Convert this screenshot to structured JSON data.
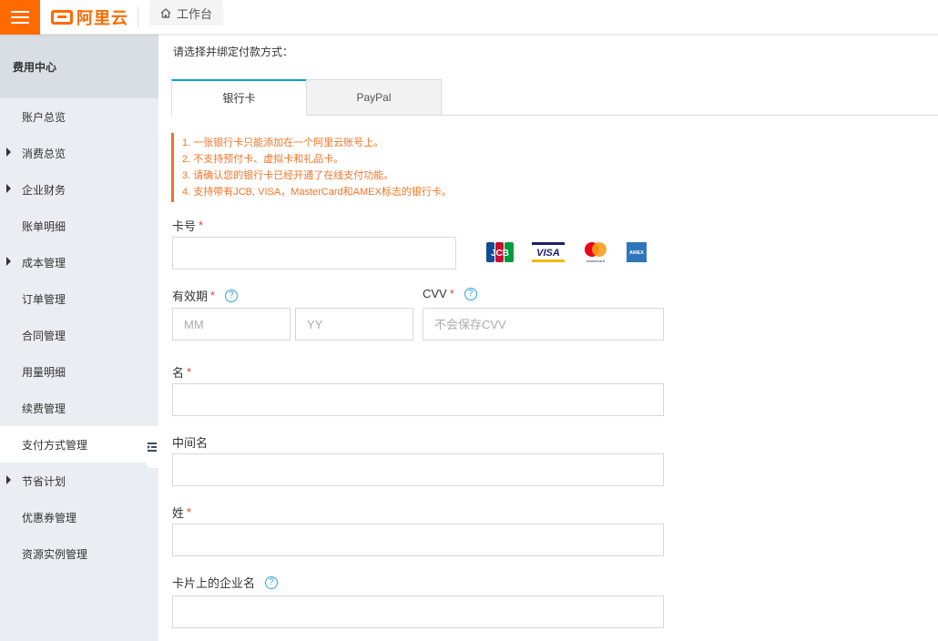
{
  "header": {
    "logo_text": "阿里云",
    "workbench_label": "工作台",
    "brand_color": "#ff6a00"
  },
  "sidebar": {
    "title": "费用中心",
    "items": [
      {
        "label": "账户总览",
        "expandable": false
      },
      {
        "label": "消费总览",
        "expandable": true
      },
      {
        "label": "企业财务",
        "expandable": true
      },
      {
        "label": "账单明细",
        "expandable": false
      },
      {
        "label": "成本管理",
        "expandable": true
      },
      {
        "label": "订单管理",
        "expandable": false
      },
      {
        "label": "合同管理",
        "expandable": false
      },
      {
        "label": "用量明细",
        "expandable": false
      },
      {
        "label": "续费管理",
        "expandable": false
      },
      {
        "label": "支付方式管理",
        "expandable": false,
        "active": true
      },
      {
        "label": "节省计划",
        "expandable": true
      },
      {
        "label": "优惠券管理",
        "expandable": false
      },
      {
        "label": "资源实例管理",
        "expandable": false
      }
    ]
  },
  "main": {
    "prompt": "请选择并绑定付款方式：",
    "tabs": [
      {
        "label": "银行卡",
        "active": true
      },
      {
        "label": "PayPal",
        "active": false
      }
    ],
    "notices": [
      "1. 一张银行卡只能添加在一个阿里云账号上。",
      "2. 不支持预付卡、虚拟卡和礼品卡。",
      "3. 请确认您的银行卡已经开通了在线支付功能。",
      "4. 支持带有JCB, VISA，MasterCard和AMEX标志的银行卡。"
    ],
    "notice_color": "#f37327",
    "form": {
      "card_number": {
        "label": "卡号",
        "value": ""
      },
      "expiry": {
        "label": "有效期",
        "month_placeholder": "MM",
        "year_placeholder": "YY"
      },
      "cvv": {
        "label": "CVV",
        "placeholder": "不会保存CVV"
      },
      "first_name": {
        "label": "名",
        "value": ""
      },
      "middle_name": {
        "label": "中间名",
        "value": ""
      },
      "last_name": {
        "label": "姓",
        "value": ""
      },
      "company": {
        "label": "卡片上的企业名",
        "value": ""
      }
    },
    "card_brands": [
      "JCB",
      "VISA",
      "mastercard",
      "AMEX"
    ]
  }
}
